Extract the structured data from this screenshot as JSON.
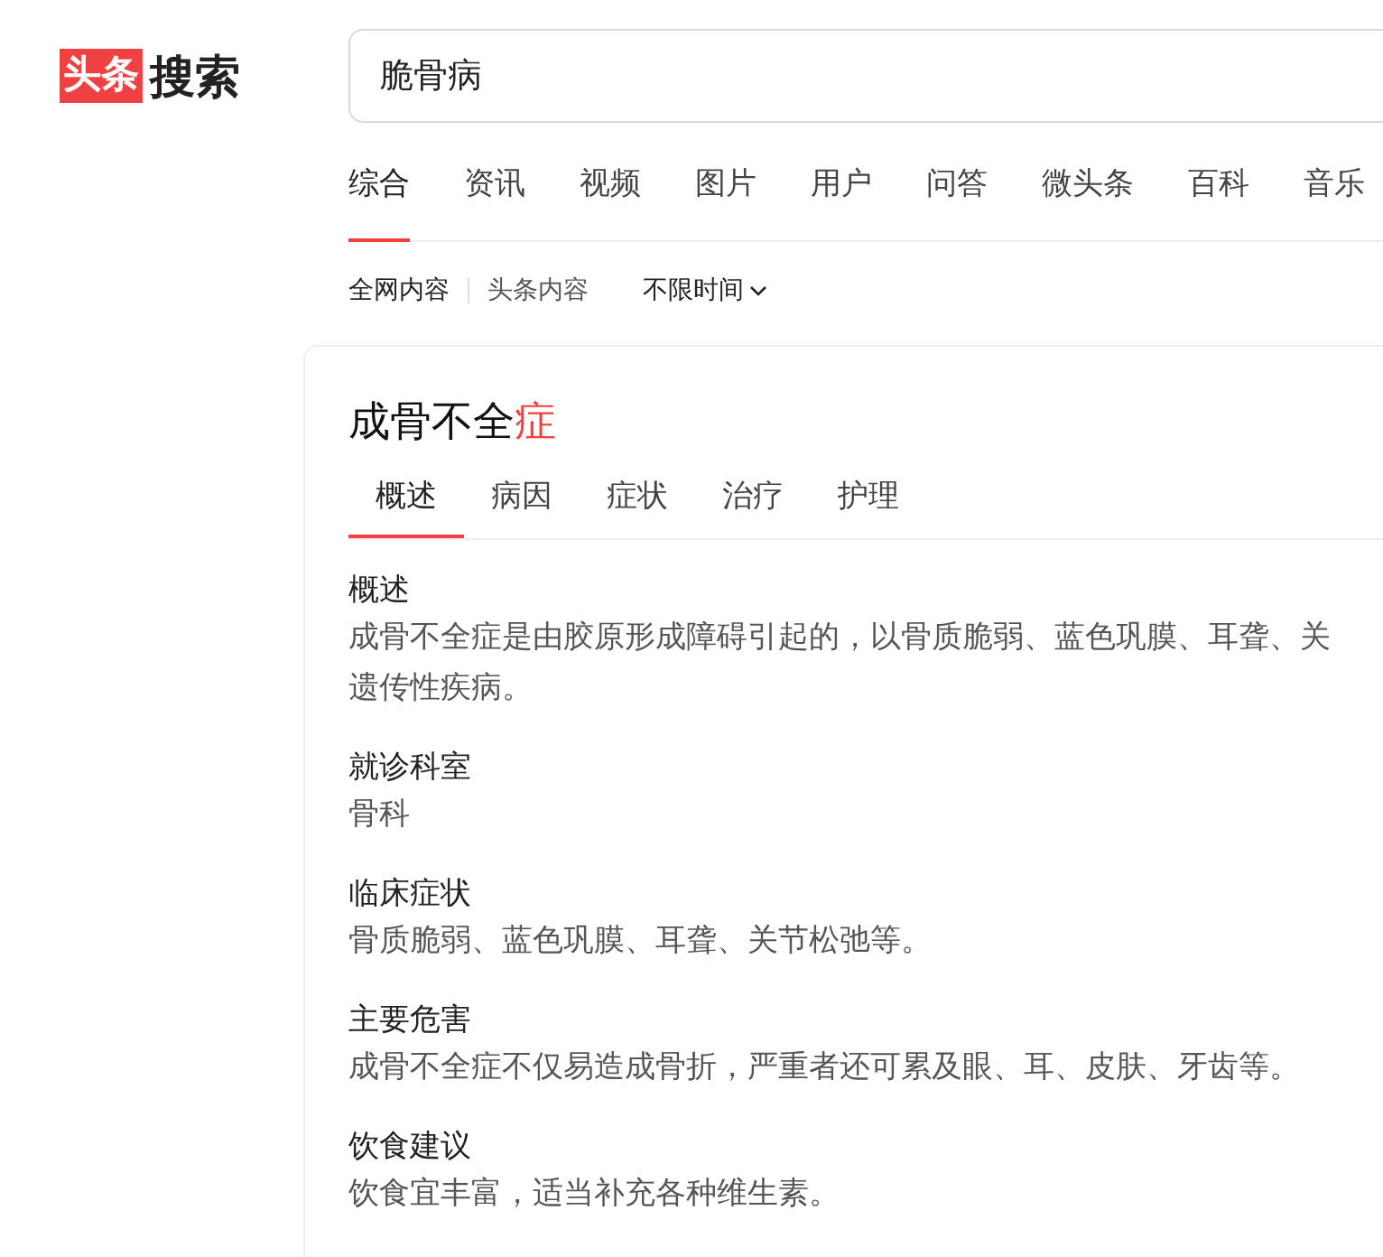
{
  "logo": {
    "badge": "头条",
    "text": "搜索"
  },
  "search": {
    "value": "脆骨病"
  },
  "tabs": [
    {
      "label": "综合",
      "selected": true
    },
    {
      "label": "资讯",
      "selected": false
    },
    {
      "label": "视频",
      "selected": false
    },
    {
      "label": "图片",
      "selected": false
    },
    {
      "label": "用户",
      "selected": false
    },
    {
      "label": "问答",
      "selected": false
    },
    {
      "label": "微头条",
      "selected": false
    },
    {
      "label": "百科",
      "selected": false
    },
    {
      "label": "音乐",
      "selected": false
    }
  ],
  "filters": {
    "sources": [
      {
        "label": "全网内容",
        "selected": true
      },
      {
        "label": "头条内容",
        "selected": false
      }
    ],
    "time": "不限时间"
  },
  "card": {
    "title": "成骨不全**症**",
    "tabs": [
      {
        "label": "概述",
        "selected": true
      },
      {
        "label": "病因",
        "selected": false
      },
      {
        "label": "症状",
        "selected": false
      },
      {
        "label": "治疗",
        "selected": false
      },
      {
        "label": "护理",
        "selected": false
      }
    ],
    "sections": [
      {
        "heading": "概述",
        "lines": [
          "成骨不全症是由胶原形成障碍引起的，以骨质脆弱、蓝色巩膜、耳聋、关",
          "遗传性疾病。"
        ]
      },
      {
        "heading": "就诊科室",
        "lines": [
          "骨科"
        ]
      },
      {
        "heading": "临床症状",
        "lines": [
          "骨质脆弱、蓝色巩膜、耳聋、关节松弛等。"
        ]
      },
      {
        "heading": "主要危害",
        "lines": [
          "成骨不全症不仅易造成骨折，严重者还可累及眼、耳、皮肤、牙齿等。"
        ]
      },
      {
        "heading": "饮食建议",
        "lines": [
          "饮食宜丰富，适当补充各种维生素。"
        ]
      }
    ]
  }
}
